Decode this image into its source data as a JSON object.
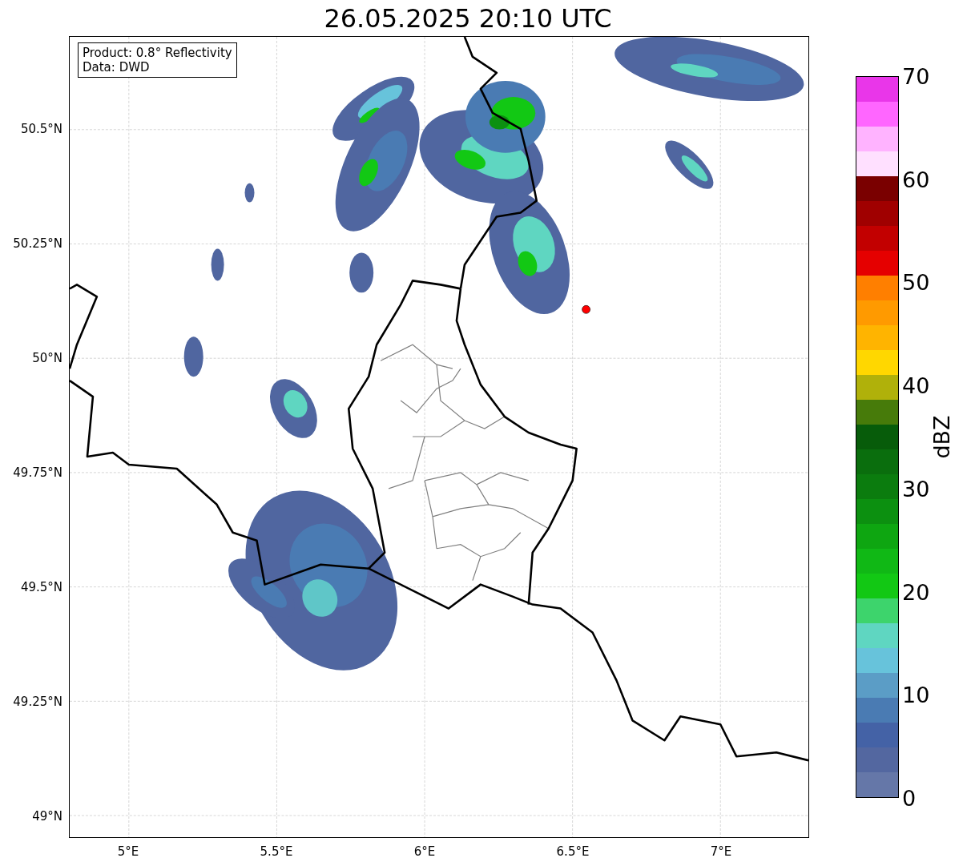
{
  "title": "26.05.2025 20:10 UTC",
  "info_box": {
    "lines": [
      "Product: 0.8° Reflectivity",
      "Data: DWD"
    ]
  },
  "map": {
    "lat_ticks": [
      "50.5°N",
      "50.25°N",
      "50°N",
      "49.75°N",
      "49.5°N",
      "49.25°N",
      "49°N"
    ],
    "lon_ticks": [
      "5°E",
      "5.5°E",
      "6°E",
      "6.5°E",
      "7°E"
    ]
  },
  "colorbar": {
    "ticks": [
      "70",
      "60",
      "50",
      "40",
      "30",
      "20",
      "10",
      "0"
    ],
    "label": "dBZ",
    "bins": [
      {
        "color": "#e936e9"
      },
      {
        "color": "#ff66ff"
      },
      {
        "color": "#ffb3ff"
      },
      {
        "color": "#ffe0ff"
      },
      {
        "color": "#7a0000"
      },
      {
        "color": "#a00000"
      },
      {
        "color": "#c20000"
      },
      {
        "color": "#e50000"
      },
      {
        "color": "#ff7f00"
      },
      {
        "color": "#ff9a00"
      },
      {
        "color": "#ffb400"
      },
      {
        "color": "#ffd700"
      },
      {
        "color": "#b0b10a"
      },
      {
        "color": "#477b0a"
      },
      {
        "color": "#075c0a"
      },
      {
        "color": "#0a6e0d"
      },
      {
        "color": "#0b7c0e"
      },
      {
        "color": "#0c9010"
      },
      {
        "color": "#0ea611"
      },
      {
        "color": "#10b815"
      },
      {
        "color": "#12c814"
      },
      {
        "color": "#3dd46c"
      },
      {
        "color": "#5fd6c1"
      },
      {
        "color": "#67c3db"
      },
      {
        "color": "#5b9dc6"
      },
      {
        "color": "#4a7bb3"
      },
      {
        "color": "#4462a6"
      },
      {
        "color": "#5367a0"
      },
      {
        "color": "#6577a8"
      }
    ]
  }
}
